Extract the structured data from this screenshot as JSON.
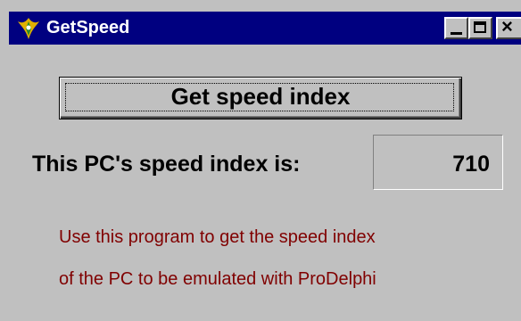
{
  "window": {
    "title": "GetSpeed",
    "controls": {
      "minimize": "minimize",
      "maximize": "maximize",
      "close": "close"
    }
  },
  "main": {
    "button_label": "Get speed index",
    "result_label": "This PC's speed index is:",
    "result_value": "710",
    "info_line1": "Use this program to get the speed index",
    "info_line2": "of the PC to be emulated with ProDelphi"
  },
  "colors": {
    "titlebar": "#000080",
    "window_bg": "#c0c0c0",
    "info_text": "#800000"
  },
  "icons": [
    "app-icon",
    "minimize-icon",
    "maximize-icon",
    "close-icon"
  ]
}
